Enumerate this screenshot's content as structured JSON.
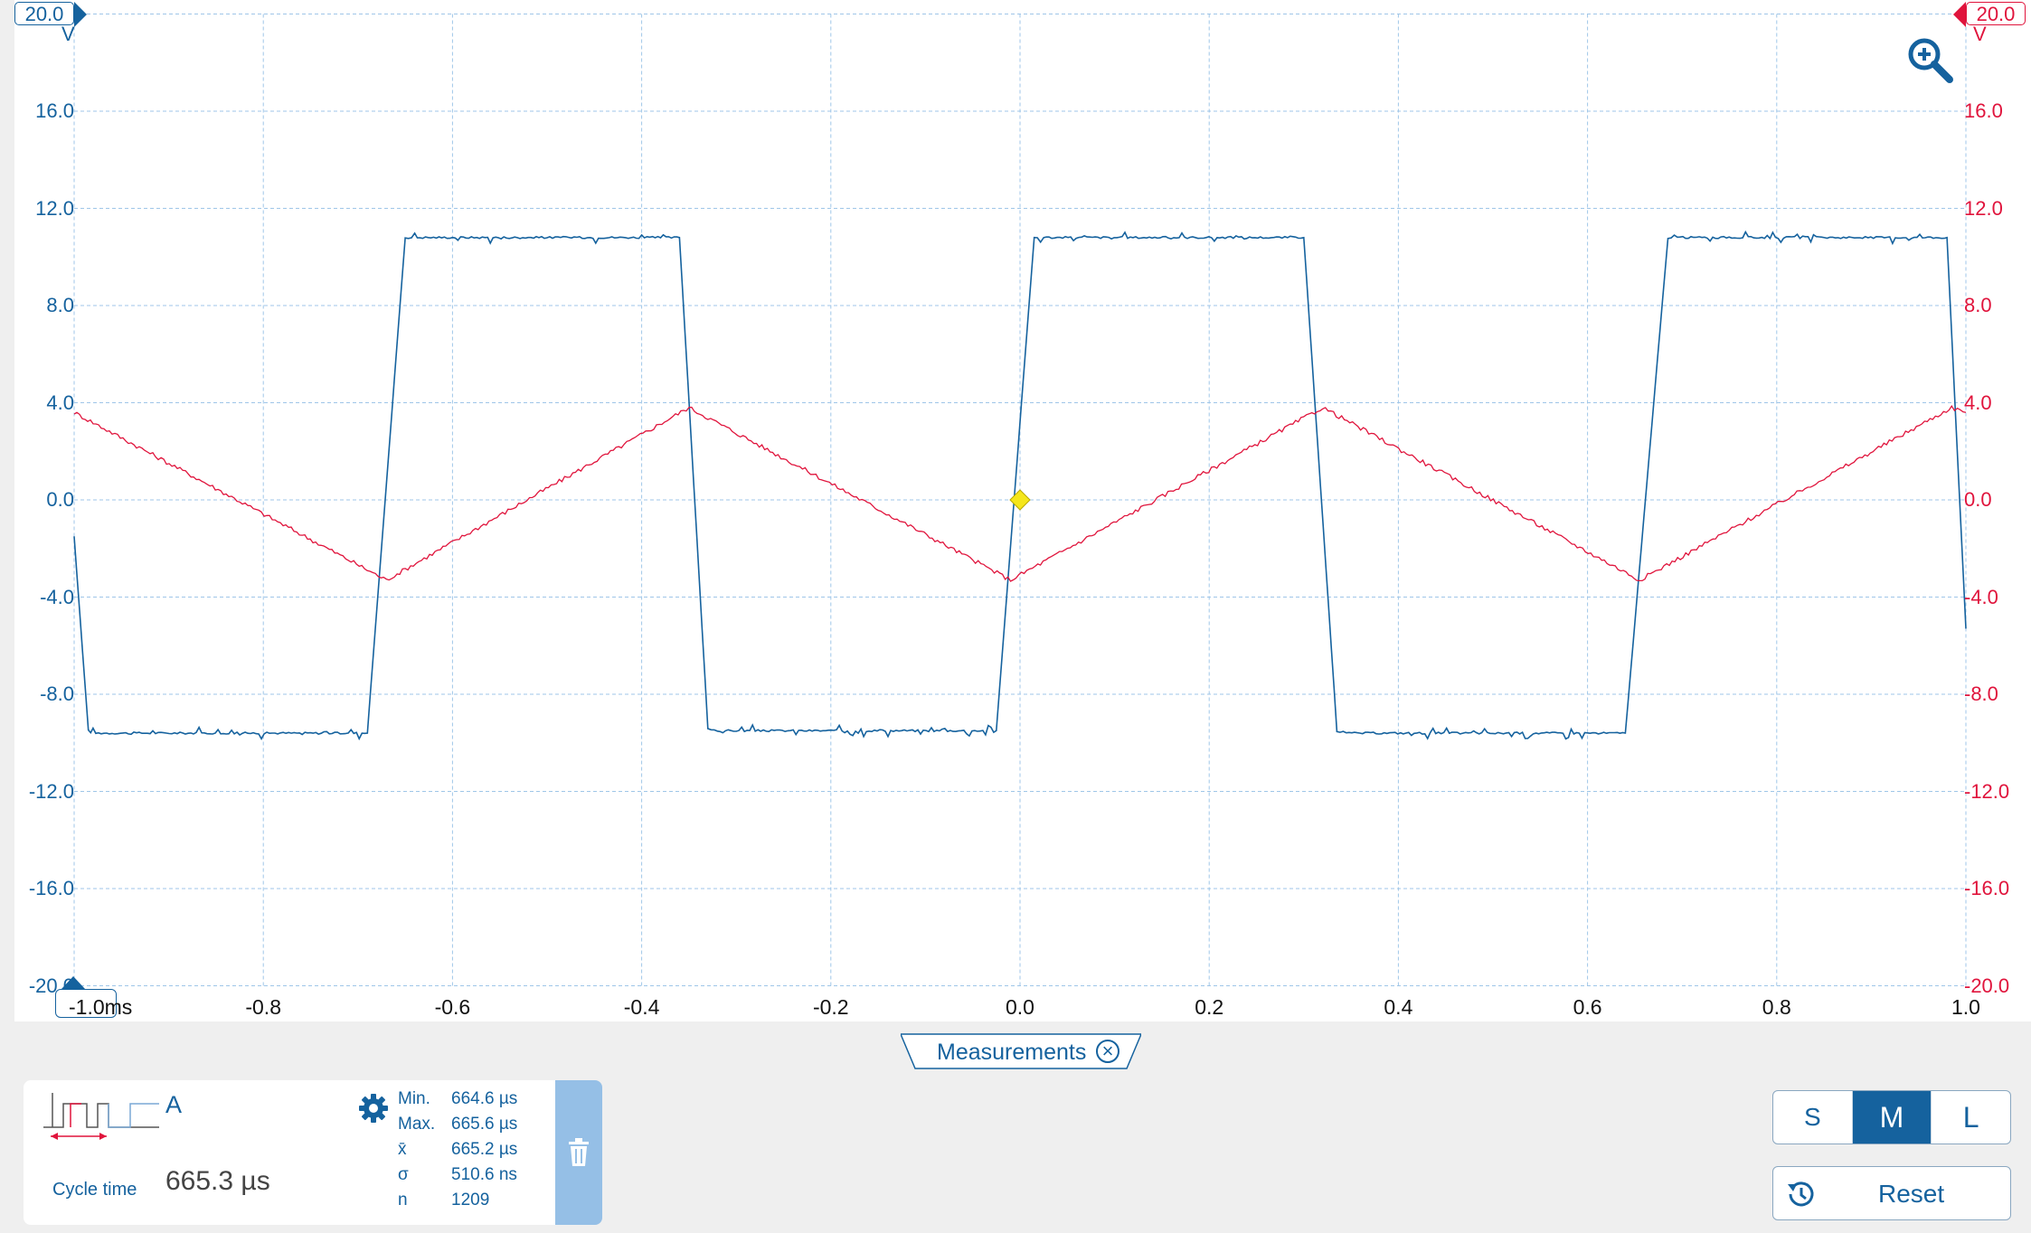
{
  "scope": {
    "left_range": "20.0",
    "left_unit": "V",
    "right_range": "20.0",
    "right_unit": "V",
    "y_ticks_left": [
      "16.0",
      "12.0",
      "8.0",
      "4.0",
      "0.0",
      "-4.0",
      "-8.0",
      "-12.0",
      "-16.0",
      "-20.0"
    ],
    "y_ticks_right": [
      "16.0",
      "12.0",
      "8.0",
      "4.0",
      "0.0",
      "-4.0",
      "-8.0",
      "-12.0",
      "-16.0",
      "-20.0"
    ],
    "x_ticks": [
      "-0.8",
      "-0.6",
      "-0.4",
      "-0.2",
      "0.0",
      "0.2",
      "0.4",
      "0.6",
      "0.8",
      "1.0"
    ],
    "x_start_label": "-1.0ms",
    "zoom_icon": "zoom-in-icon",
    "colors": {
      "channel_a": "#15629e",
      "channel_b": "#e0143c",
      "trigger": "#f5e61a",
      "grid": "#9fc6e8"
    }
  },
  "chart_data": {
    "type": "line",
    "x_unit": "ms",
    "xlim": [
      -1.0,
      1.0
    ],
    "ylim": [
      -20.0,
      20.0
    ],
    "y_unit": "V",
    "grid": true,
    "trigger": {
      "x": 0.0,
      "y": 0.0
    },
    "series": [
      {
        "axis": "left",
        "color": "#15629e",
        "x": [
          -1.0,
          -0.985,
          -0.98,
          -0.69,
          -0.65,
          -0.64,
          -0.36,
          -0.33,
          -0.32,
          -0.025,
          0.015,
          0.025,
          0.3,
          0.335,
          0.345,
          0.64,
          0.685,
          0.695,
          0.98,
          1.0
        ],
        "y": [
          -1.5,
          -9.5,
          -9.6,
          -9.6,
          10.8,
          10.8,
          10.8,
          -9.4,
          -9.5,
          -9.5,
          10.8,
          10.8,
          10.8,
          -9.5,
          -9.6,
          -9.6,
          10.8,
          10.8,
          10.8,
          -5.3
        ]
      },
      {
        "axis": "right",
        "color": "#e0143c",
        "x": [
          -1.0,
          -0.67,
          -0.35,
          -0.01,
          0.32,
          0.655,
          0.985,
          1.0
        ],
        "y": [
          3.6,
          -3.3,
          3.8,
          -3.3,
          3.8,
          -3.3,
          3.8,
          3.6
        ]
      }
    ]
  },
  "measurements": {
    "tab_label": "Measurements",
    "close_icon": "close-circle-icon",
    "card": {
      "channel": "A",
      "type_label": "Cycle time",
      "value": "665.3 µs",
      "settings_icon": "gear-icon",
      "delete_icon": "trash-icon",
      "waveform_icon": "cycle-time-icon",
      "stats": [
        {
          "key": "Min.",
          "value": "664.6 µs"
        },
        {
          "key": "Max.",
          "value": "665.6 µs"
        },
        {
          "key": "x̄",
          "value": "665.2 µs"
        },
        {
          "key": "σ",
          "value": "510.6 ns"
        },
        {
          "key": "n",
          "value": "1209"
        }
      ]
    }
  },
  "controls": {
    "sizes": [
      "S",
      "M",
      "L"
    ],
    "active_size": "M",
    "reset_label": "Reset",
    "reset_icon": "history-icon"
  }
}
